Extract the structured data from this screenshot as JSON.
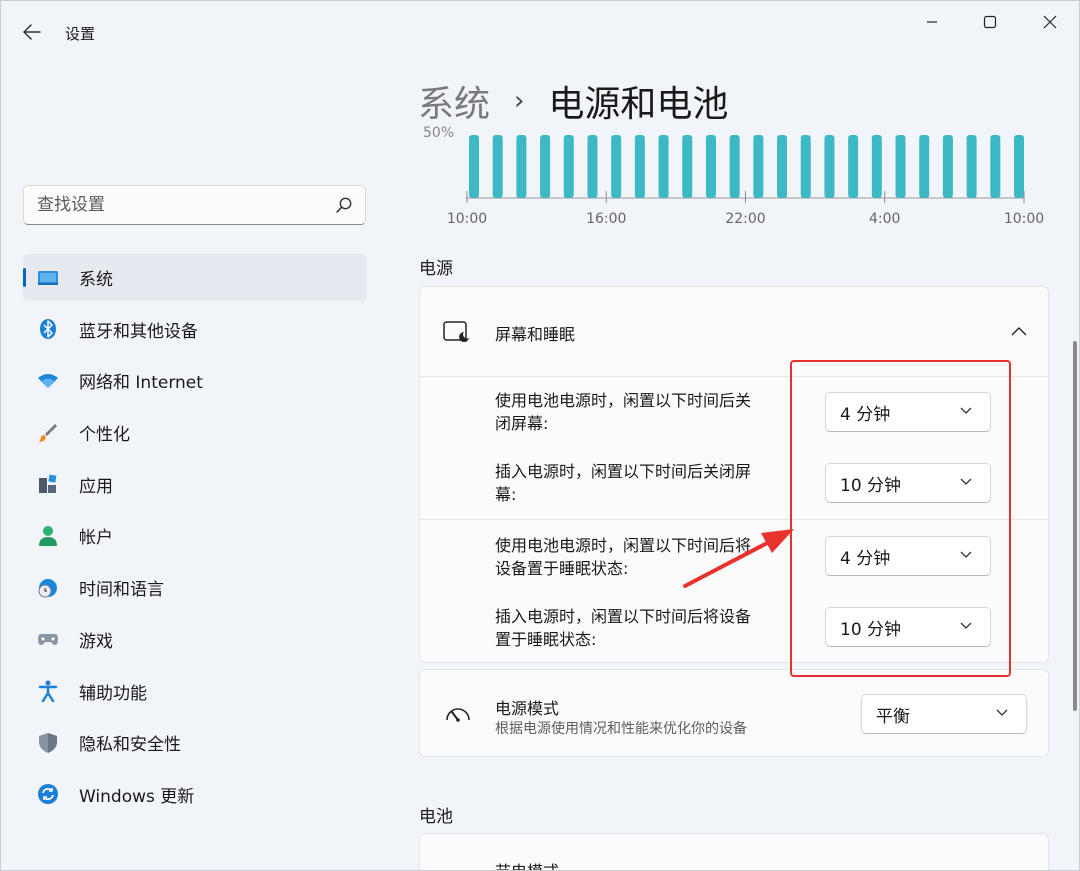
{
  "window": {
    "title": "设置",
    "controls": {
      "minimize": "–",
      "maximize": "□",
      "close": "✕"
    }
  },
  "breadcrumb": {
    "parent": "系统",
    "separator": "›",
    "current": "电源和电池"
  },
  "search": {
    "placeholder": "查找设置"
  },
  "sidebar": {
    "items": [
      {
        "label": "系统",
        "icon": "monitor-icon",
        "active": true
      },
      {
        "label": "蓝牙和其他设备",
        "icon": "bluetooth-icon"
      },
      {
        "label": "网络和 Internet",
        "icon": "wifi-icon"
      },
      {
        "label": "个性化",
        "icon": "brush-icon"
      },
      {
        "label": "应用",
        "icon": "apps-icon"
      },
      {
        "label": "帐户",
        "icon": "person-icon"
      },
      {
        "label": "时间和语言",
        "icon": "globe-clock-icon"
      },
      {
        "label": "游戏",
        "icon": "gamepad-icon"
      },
      {
        "label": "辅助功能",
        "icon": "accessibility-icon"
      },
      {
        "label": "隐私和安全性",
        "icon": "shield-icon"
      },
      {
        "label": "Windows 更新",
        "icon": "update-icon"
      }
    ]
  },
  "chart_data": {
    "type": "bar",
    "x_tick_labels": [
      "10:00",
      "16:00",
      "22:00",
      "4:00",
      "10:00"
    ],
    "partial_y_label": "50%",
    "bar_count": 24,
    "color": "#3cb9c4"
  },
  "power": {
    "section_title": "电源",
    "screen_sleep": {
      "title": "屏幕和睡眠",
      "rows": [
        {
          "line1": "使用电池电源时，闲置以下时间后关",
          "line2": "闭屏幕:",
          "value": "4 分钟"
        },
        {
          "line1": "插入电源时，闲置以下时间后关闭屏",
          "line2": "幕:",
          "value": "10 分钟"
        },
        {
          "line1": "使用电池电源时，闲置以下时间后将",
          "line2": "设备置于睡眠状态:",
          "value": "4 分钟"
        },
        {
          "line1": "插入电源时，闲置以下时间后将设备",
          "line2": "置于睡眠状态:",
          "value": "10 分钟"
        }
      ]
    },
    "power_mode": {
      "title": "电源模式",
      "description": "根据电源使用情况和性能来优化你的设备",
      "value": "平衡"
    }
  },
  "battery": {
    "section_title": "电池",
    "battery_saver_title": "节电模式"
  },
  "colors": {
    "accent": "#0067c0",
    "annotation_red": "#e8322e",
    "chart_teal": "#3cb9c4"
  }
}
